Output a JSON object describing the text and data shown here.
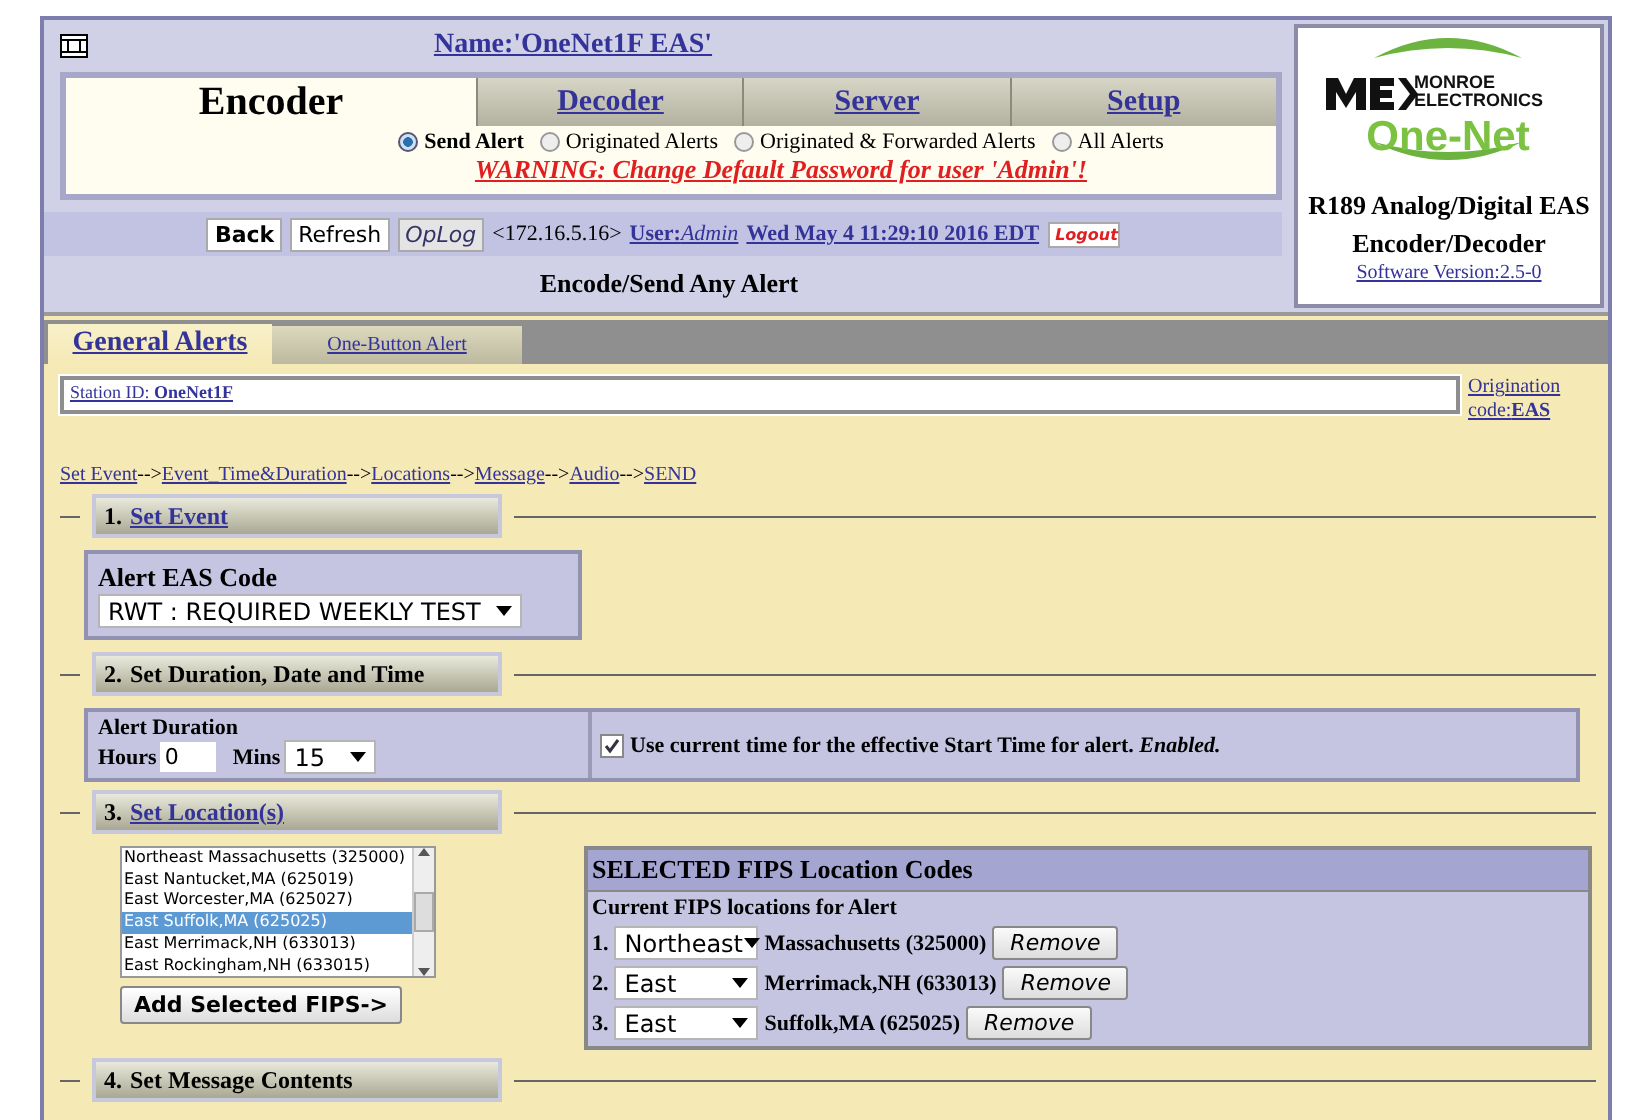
{
  "header": {
    "name": "Name:'OneNet1F EAS'",
    "tabs": [
      {
        "label": "Encoder",
        "selected": true
      },
      {
        "label": "Decoder",
        "selected": false
      },
      {
        "label": "Server",
        "selected": false
      },
      {
        "label": "Setup",
        "selected": false
      }
    ],
    "views": [
      {
        "label": "Send Alert",
        "selected": true
      },
      {
        "label": "Originated Alerts",
        "selected": false
      },
      {
        "label": "Originated & Forwarded Alerts",
        "selected": false
      },
      {
        "label": "All Alerts",
        "selected": false
      }
    ],
    "warning": "WARNING: Change Default Password for user 'Admin'!",
    "buttons": [
      {
        "label": "Back",
        "kind": "bold"
      },
      {
        "label": "Refresh",
        "kind": "plain"
      },
      {
        "label": "OpLog",
        "kind": "italic"
      }
    ],
    "address": "<172.16.5.16>",
    "user_label": "User:",
    "user": "Admin",
    "datetime": "Wed May 4 11:29:10 2016 EDT",
    "logout": "Logout",
    "page_title": "Encode/Send Any Alert"
  },
  "product": {
    "brand_top": "MONROE",
    "brand_bottom": "ELECTRONICS",
    "logo": "One-Net",
    "model": "R189 Analog/Digital EAS",
    "subtitle": "Encoder/Decoder",
    "version": "Software Version:2.5-0"
  },
  "subtabs": [
    {
      "label": "General Alerts",
      "selected": true
    },
    {
      "label": "One-Button Alert",
      "selected": false
    }
  ],
  "station": {
    "label": "Station ID:",
    "value": "OneNet1F"
  },
  "origination": {
    "label": "Origination code:",
    "value": "EAS"
  },
  "steps": {
    "separator": "-->",
    "items": [
      "Set Event",
      "Event_Time&Duration",
      "Locations",
      "Message",
      "Audio",
      "SEND"
    ]
  },
  "sections": [
    {
      "number": "1.",
      "title": "Set Event",
      "link": true,
      "kind": "event"
    },
    {
      "number": "2.",
      "title": "Set Duration, Date and Time",
      "link": false,
      "kind": "duration"
    },
    {
      "number": "3.",
      "title": "Set Location(s)",
      "link": true,
      "kind": "location"
    },
    {
      "number": "4.",
      "title": "Set Message Contents",
      "link": false,
      "kind": "message"
    }
  ],
  "event": {
    "label": "Alert EAS Code",
    "value": "RWT : REQUIRED WEEKLY TEST"
  },
  "duration": {
    "label": "Alert Duration",
    "hours_label": "Hours",
    "hours": "0",
    "mins_label": "Mins",
    "mins": "15",
    "current_time_checked": true,
    "current_time_text": "Use current time for the effective Start Time for alert. *Enabled.*"
  },
  "location": {
    "list": [
      {
        "text": "Northeast Massachusetts (325000)",
        "selected": false
      },
      {
        "text": "East Nantucket,MA (625019)",
        "selected": false
      },
      {
        "text": "East Worcester,MA (625027)",
        "selected": false
      },
      {
        "text": "East Suffolk,MA (625025)",
        "selected": true
      },
      {
        "text": "East Merrimack,NH (633013)",
        "selected": false
      },
      {
        "text": "East Rockingham,NH (633015)",
        "selected": false
      }
    ],
    "add_button": "Add Selected FIPS->",
    "panel_title": "SELECTED FIPS Location Codes",
    "panel_subtitle": "Current FIPS locations for Alert",
    "codes": [
      {
        "number": "1.",
        "part": "Northeast",
        "name": "Massachusetts (325000)",
        "remove": "Remove"
      },
      {
        "number": "2.",
        "part": "East",
        "name": "Merrimack,NH (633013)",
        "remove": "Remove"
      },
      {
        "number": "3.",
        "part": "East",
        "name": "Suffolk,MA (625025)",
        "remove": "Remove"
      }
    ]
  }
}
